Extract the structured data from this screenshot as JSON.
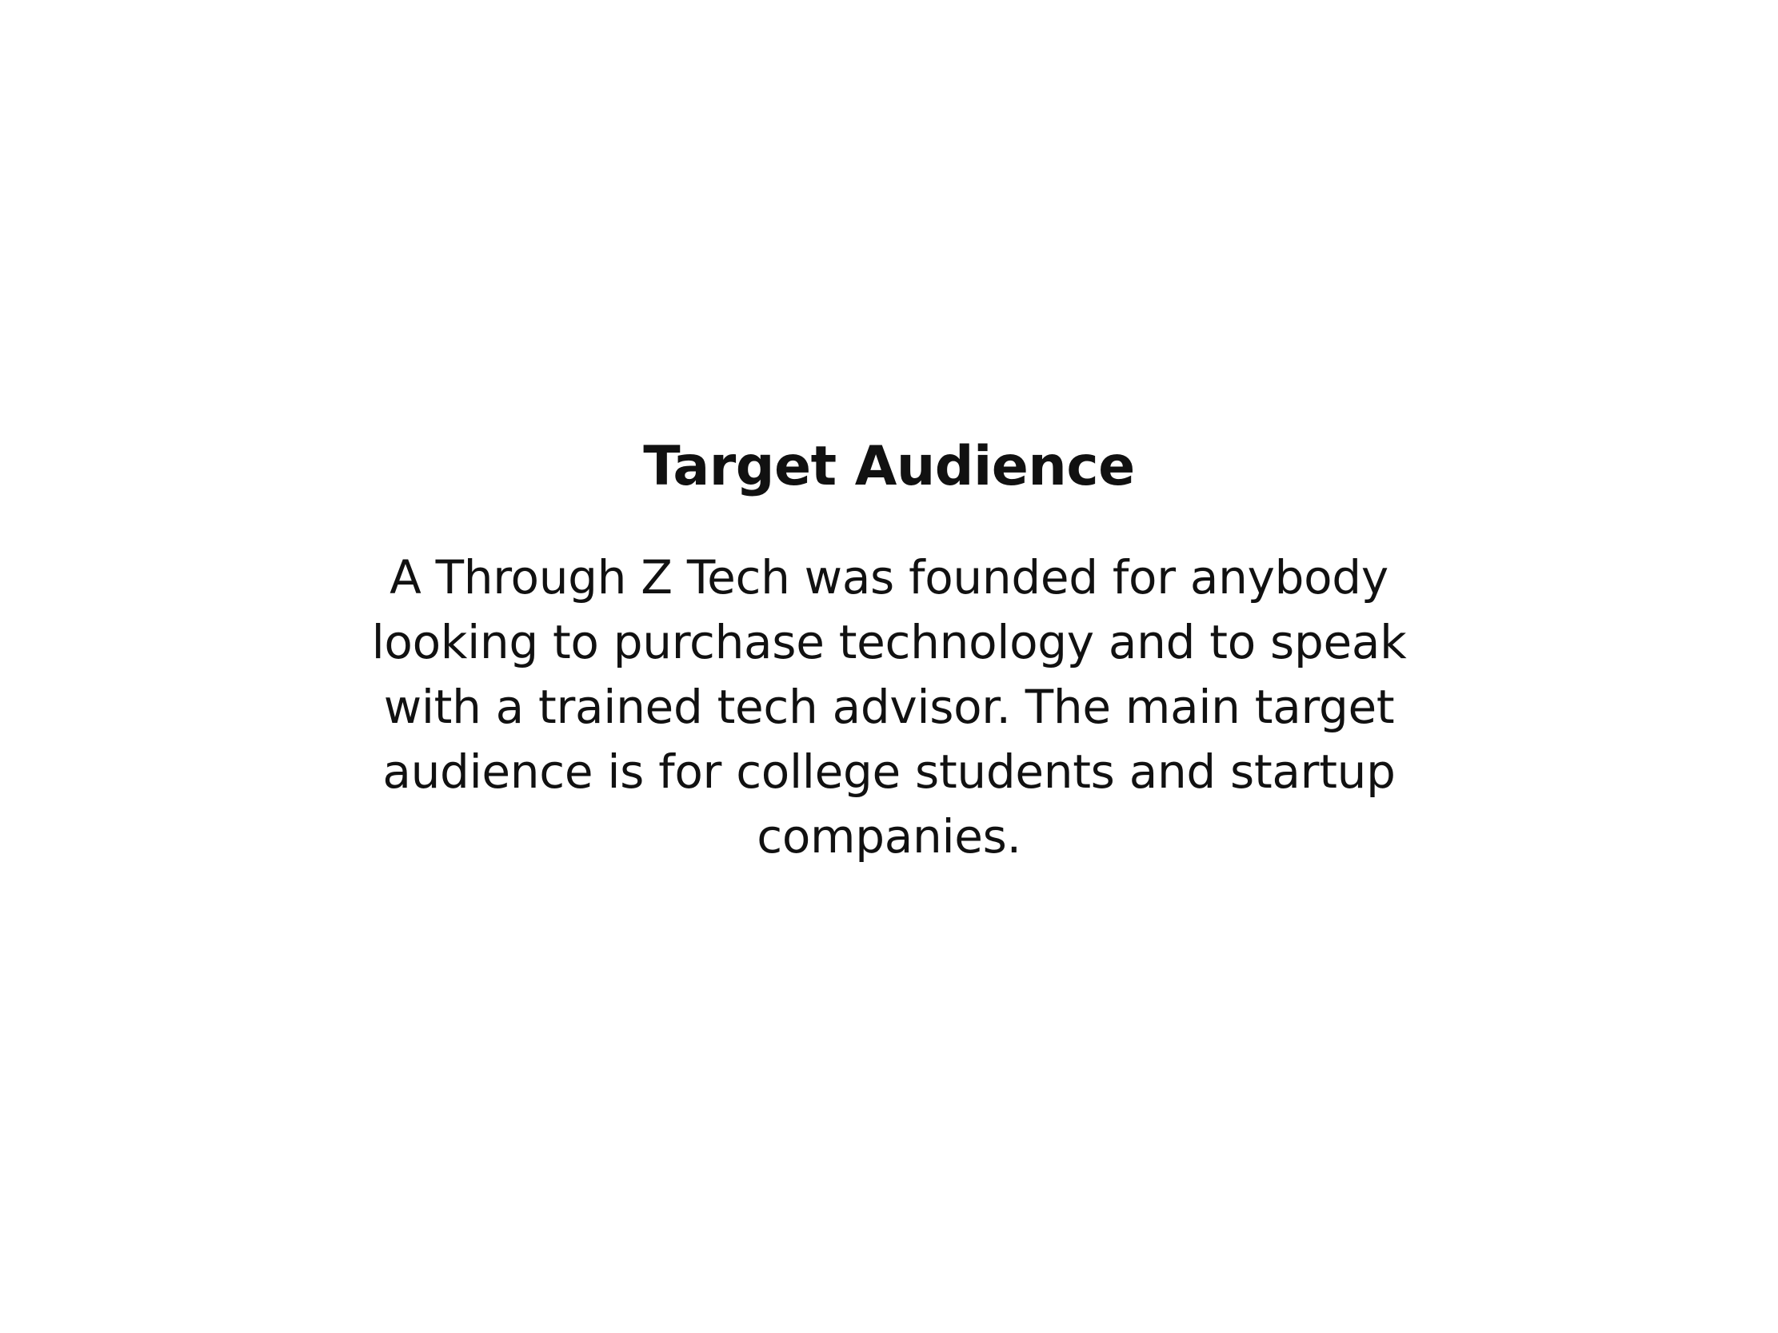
{
  "slide": {
    "title": "Target Audience",
    "body": "A Through Z Tech was founded for anybody looking to purchase technology and to speak with a trained tech advisor. The main target audience is for college students and startup companies."
  },
  "colors": {
    "background": "#ffffff",
    "text": "#111111"
  }
}
